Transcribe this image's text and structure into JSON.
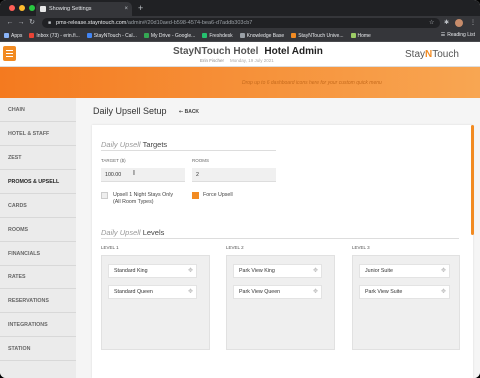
{
  "browser": {
    "tab_title": "Showing Settings",
    "tab_close": "×",
    "new_tab": "+",
    "url_host": "pms-release.stayntouch.com",
    "url_path": "/admin#/20d10aed-b598-4574-bea6-d7addb303cb7",
    "bookmarks": [
      {
        "label": "Apps",
        "color": "#8ab4f8"
      },
      {
        "label": "Inbox (73) - erin.fi...",
        "color": "#ea4335"
      },
      {
        "label": "StayNTouch - Cal...",
        "color": "#4285f4"
      },
      {
        "label": "My Drive - Google...",
        "color": "#34a853"
      },
      {
        "label": "Freshdesk",
        "color": "#25c16f"
      },
      {
        "label": "Knowledge Base",
        "color": "#9aa0a6"
      },
      {
        "label": "StayNTouch Unive...",
        "color": "#f28b22"
      },
      {
        "label": "Home",
        "color": "#9ccc65"
      }
    ],
    "reading_list": "Reading List"
  },
  "header": {
    "hotel": "StayNTouch Hotel",
    "section": "Hotel Admin",
    "user": "Erin Fischer",
    "date": "Monday, 19 July 2021",
    "brand_pre": "Stay",
    "brand_n": "N",
    "brand_post": "Touch"
  },
  "banner": {
    "hint": "Drop up to 6 dashboard icons here for your custom quick menu"
  },
  "sidebar": {
    "items": [
      {
        "label": "CHAIN"
      },
      {
        "label": "HOTEL & STAFF"
      },
      {
        "label": "ZEST"
      },
      {
        "label": "PROMOS & UPSELL"
      },
      {
        "label": "CARDS"
      },
      {
        "label": "ROOMS"
      },
      {
        "label": "FINANCIALS"
      },
      {
        "label": "RATES"
      },
      {
        "label": "RESERVATIONS"
      },
      {
        "label": "INTEGRATIONS"
      },
      {
        "label": "STATION"
      }
    ]
  },
  "page": {
    "title": "Daily Upsell Setup",
    "back": "BACK"
  },
  "targets": {
    "title_italic": "Daily Upsell",
    "title_rest": "Targets",
    "target_label": "TARGET ($)",
    "target_value": "100.00",
    "rooms_label": "ROOMS",
    "rooms_value": "2",
    "one_night_line1": "Upsell 1 Night Stays Only",
    "one_night_line2": "(All Room Types)",
    "one_night_checked": false,
    "force_label": "Force Upsell",
    "force_checked": true
  },
  "levels": {
    "title_italic": "Daily Upsell",
    "title_rest": "Levels",
    "columns": [
      {
        "label": "LEVEL 1",
        "rooms": [
          "Standard King",
          "Standard Queen"
        ]
      },
      {
        "label": "LEVEL 2",
        "rooms": [
          "Park View King",
          "Park View Queen"
        ]
      },
      {
        "label": "LEVEL 3",
        "rooms": [
          "Junior Suite",
          "Park View Suite"
        ]
      }
    ]
  },
  "colors": {
    "accent": "#f28b22",
    "banner_start": "#f47a1f",
    "banner_end": "#f8a652"
  }
}
